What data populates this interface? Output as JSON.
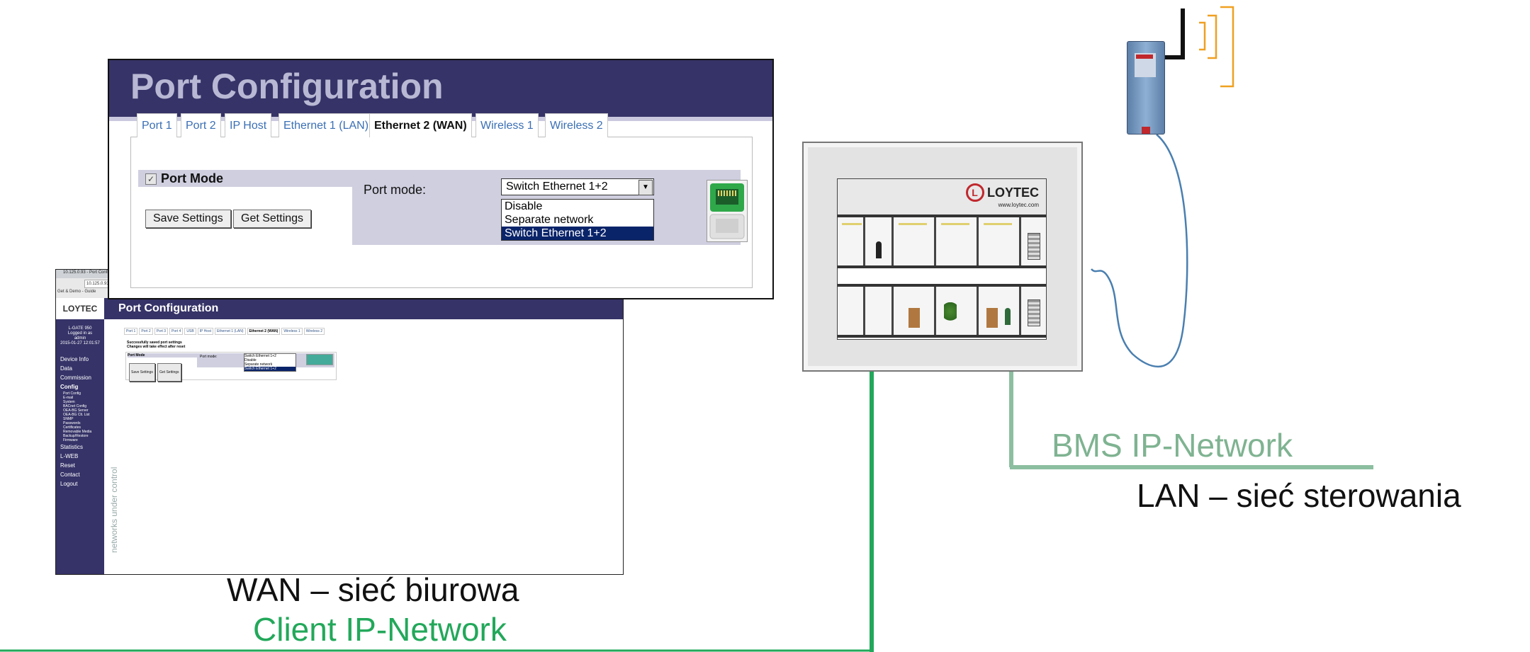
{
  "main_window": {
    "title": "Port Configuration",
    "tabs": [
      "Port 1",
      "Port 2",
      "IP Host",
      "Ethernet 1 (LAN)",
      "Ethernet 2 (WAN)",
      "Wireless 1",
      "Wireless 2"
    ],
    "active_tab": "Ethernet 2 (WAN)",
    "section_title": "Port Mode",
    "section_checked": true,
    "save_button": "Save Settings",
    "get_button": "Get Settings",
    "port_mode_label": "Port mode:",
    "port_mode_selected": "Switch Ethernet 1+2",
    "port_mode_options": [
      "Disable",
      "Separate network",
      "Switch Ethernet 1+2"
    ]
  },
  "background_window": {
    "browser_tab": "10.125.0.93 - Port Configu...",
    "address": "10.125.0.93",
    "bookmarks": "Get & Demo - Guide",
    "logo": "LOYTEC",
    "title": "Port Configuration",
    "user_info": [
      "L-GATE 950",
      "Logged in as",
      "admin",
      "2015-01-27 12:01:57"
    ],
    "nav_items": [
      "Device Info",
      "Data",
      "Commission",
      "Config"
    ],
    "config_subitems": [
      "Port Config",
      "E-mail",
      "System",
      "BACnet Config",
      "OEA-BG Server",
      "OEA-BG Clt. List",
      "SNMP",
      "Passwords",
      "Certificates",
      "Removable Media",
      "Backup/Restore",
      "Firmware"
    ],
    "nav_items_after": [
      "Statistics",
      "L-WEB",
      "Reset",
      "Contact",
      "Logout"
    ],
    "vertical_slogan": "networks under control",
    "tabs": [
      "Port 1",
      "Port 2",
      "Port 3",
      "Port 4",
      "USB",
      "IP Host",
      "Ethernet 1 (LAN)",
      "Ethernet 2 (WAN)",
      "Wireless 1",
      "Wireless 2"
    ],
    "message_line1": "Successfully saved port settings",
    "message_line2": "Changes will take effect after reset",
    "section_title": "Port Mode",
    "save_button": "Save Settings",
    "get_button": "Get Settings",
    "port_mode_label": "Port mode:",
    "port_mode_selected": "Switch Ethernet 1+2",
    "port_mode_options": [
      "Disable",
      "Separate network",
      "Switch Ethernet 1+2"
    ]
  },
  "touch_panel": {
    "logo_name": "LOYTEC",
    "logo_url": "www.loytec.com"
  },
  "labels": {
    "bms": "BMS IP-Network",
    "lan": "LAN – sieć sterowania",
    "wan": "WAN – sieć biurowa",
    "client": "Client IP-Network"
  },
  "colors": {
    "header_bg": "#363368",
    "client_network": "#22a85a",
    "bms_network": "#7fb391",
    "signal_waves": "#f0a020",
    "cable": "#4a7fb0"
  }
}
